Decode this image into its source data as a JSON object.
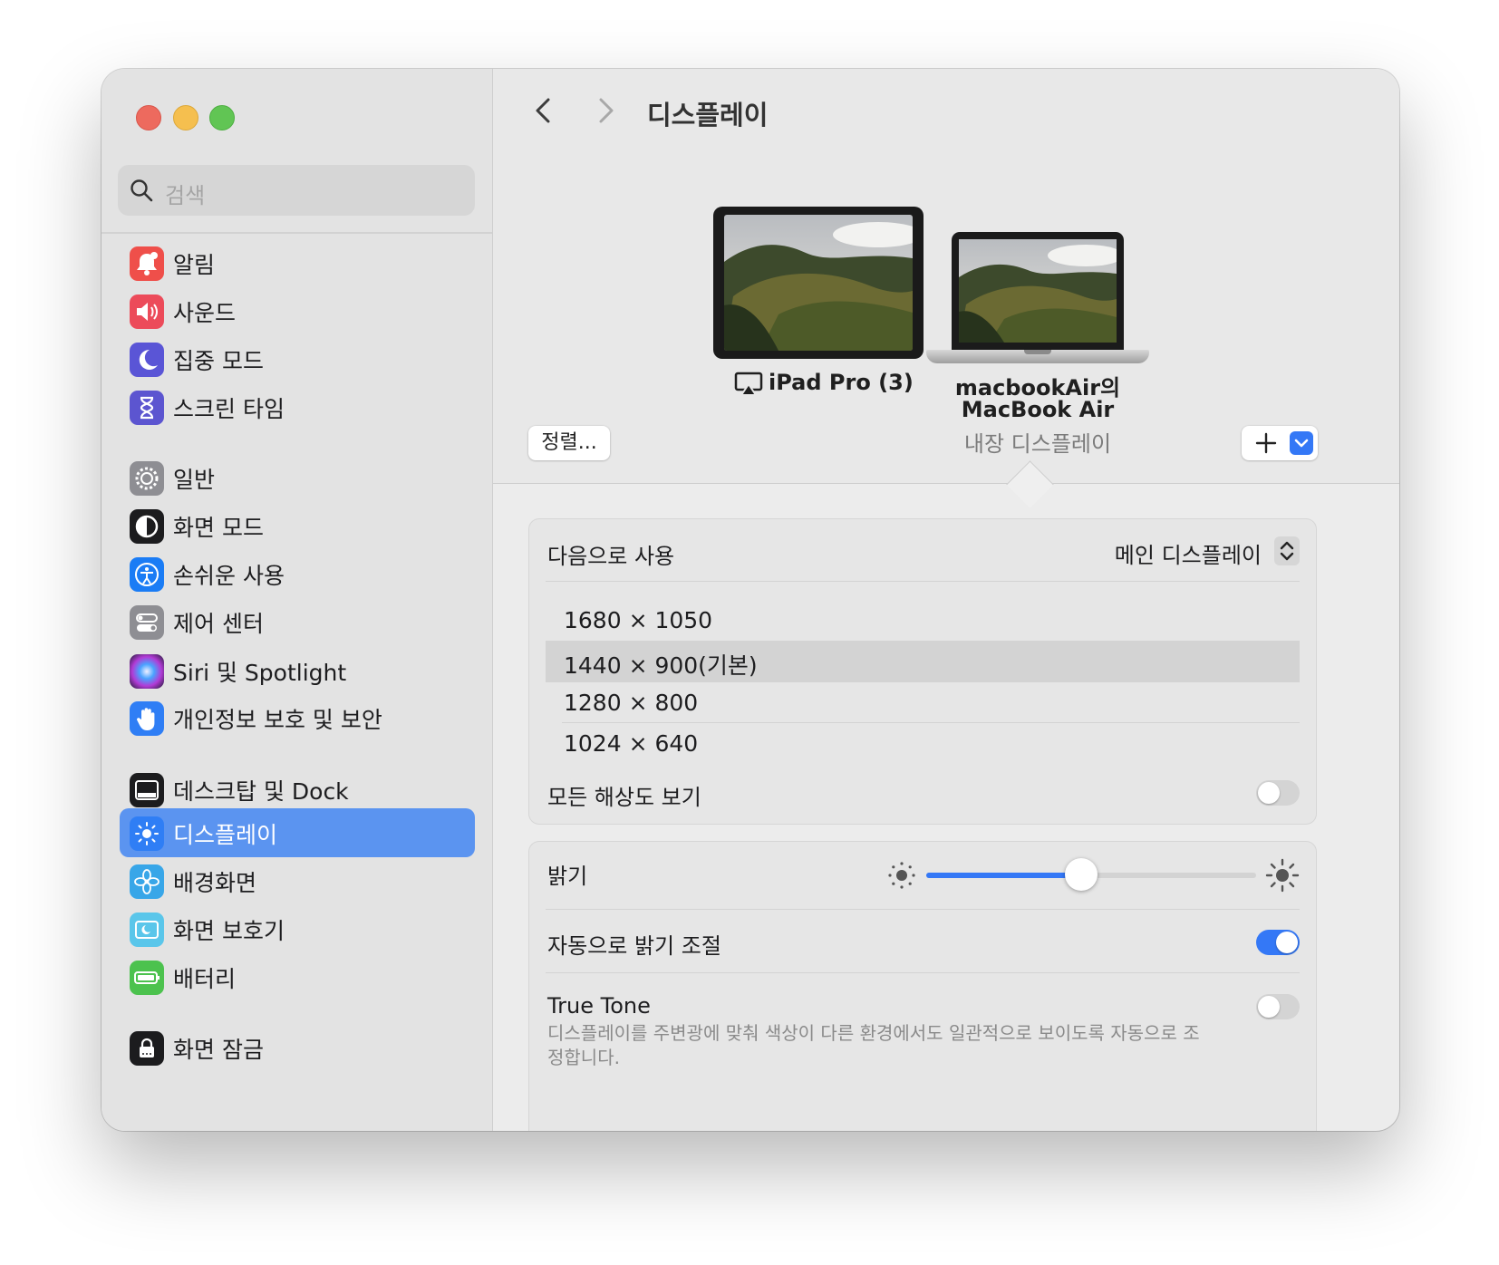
{
  "window": {
    "search_placeholder": "검색",
    "title": "디스플레이"
  },
  "sidebar": {
    "items": [
      {
        "label": "알림",
        "icon": "bell-icon",
        "color": "#ef4f4a"
      },
      {
        "label": "사운드",
        "icon": "speaker-icon",
        "color": "#ec4b5a"
      },
      {
        "label": "집중 모드",
        "icon": "moon-icon",
        "color": "#5a55d6"
      },
      {
        "label": "스크린 타임",
        "icon": "hourglass-icon",
        "color": "#5c55d0"
      },
      {
        "label": "일반",
        "icon": "gear-icon",
        "color": "#8e8e93"
      },
      {
        "label": "화면 모드",
        "icon": "appearance-icon",
        "color": "#1c1c1e"
      },
      {
        "label": "손쉬운 사용",
        "icon": "accessibility-icon",
        "color": "#1a7cf5"
      },
      {
        "label": "제어 센터",
        "icon": "control-center-icon",
        "color": "#8e8e93"
      },
      {
        "label": "Siri 및 Spotlight",
        "icon": "siri-icon",
        "color": "#8d3ac7"
      },
      {
        "label": "개인정보 보호 및 보안",
        "icon": "hand-icon",
        "color": "#2f7ef5"
      },
      {
        "label": "데스크탑 및 Dock",
        "icon": "dock-icon",
        "color": "#1c1c1e"
      },
      {
        "label": "디스플레이",
        "icon": "sun-icon",
        "color": "#2f7ef5",
        "active": true
      },
      {
        "label": "배경화면",
        "icon": "flower-icon",
        "color": "#38a6e8"
      },
      {
        "label": "화면 보호기",
        "icon": "screensaver-icon",
        "color": "#5ac6ea"
      },
      {
        "label": "배터리",
        "icon": "battery-icon",
        "color": "#4cc24e"
      },
      {
        "label": "화면 잠금",
        "icon": "lock-icon",
        "color": "#1c1c1e"
      }
    ]
  },
  "devices": {
    "ipad": {
      "name": "iPad Pro (3)",
      "icon": "airplay-icon"
    },
    "macbook": {
      "name_line1": "macbookAir의",
      "name_line2": "MacBook Air",
      "subtitle": "내장 디스플레이"
    },
    "arrange_label": "정렬..."
  },
  "settings": {
    "use_as_label": "다음으로 사용",
    "use_as_value": "메인 디스플레이",
    "resolutions": [
      {
        "label": "1680 × 1050",
        "selected": false
      },
      {
        "label": "1440 × 900(기본)",
        "selected": true
      },
      {
        "label": "1280 × 800",
        "selected": false
      },
      {
        "label": "1024 × 640",
        "selected": false
      }
    ],
    "show_all_label": "모든 해상도 보기",
    "show_all_on": false,
    "brightness_label": "밝기",
    "brightness_value": 0.47,
    "auto_brightness_label": "자동으로 밝기 조절",
    "auto_brightness_on": true,
    "true_tone_label": "True Tone",
    "true_tone_on": false,
    "true_tone_desc": "디스플레이를 주변광에 맞춰 색상이 다른 환경에서도 일관적으로 보이도록 자동으로 조정합니다.",
    "accent_color": "#3478f6"
  }
}
